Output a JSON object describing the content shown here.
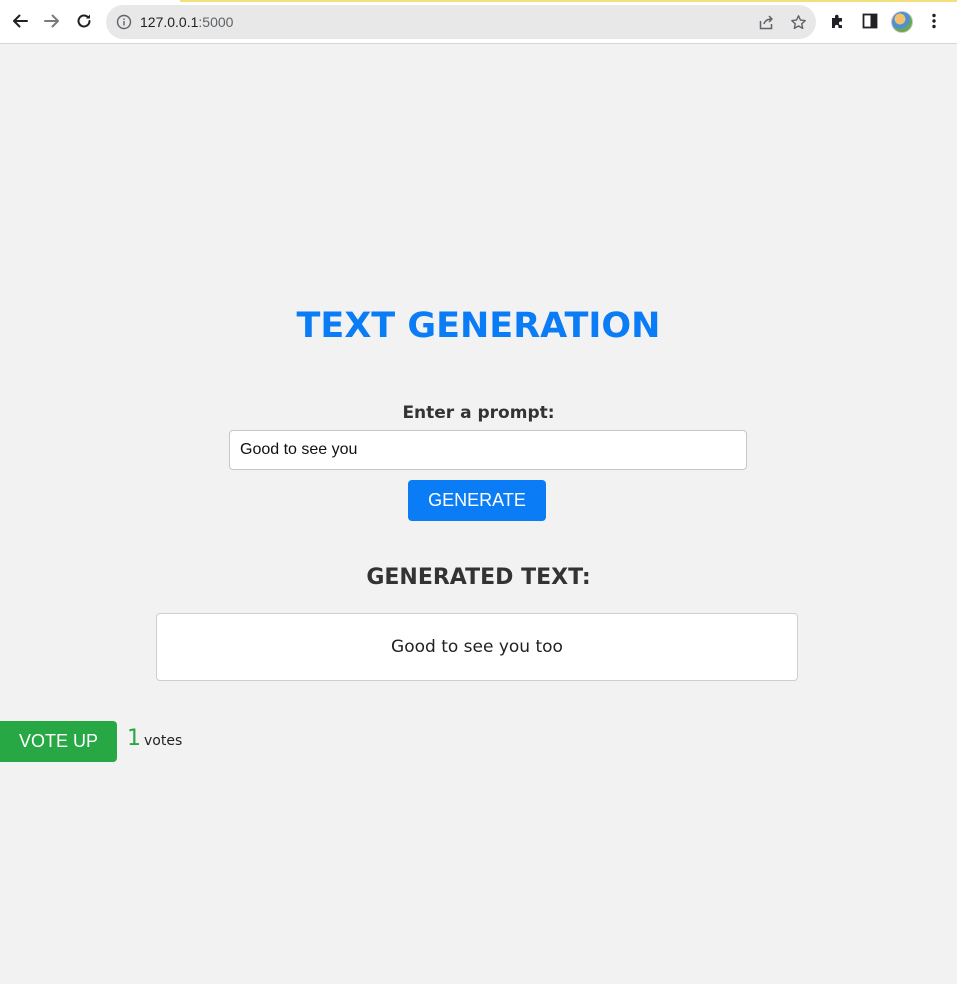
{
  "browser": {
    "url_host": "127.0.0.1",
    "url_port": ":5000"
  },
  "page": {
    "title": "TEXT GENERATION",
    "prompt_label": "Enter a prompt:",
    "prompt_value": "Good to see you",
    "generate_label": "GENERATE",
    "generated_heading": "GENERATED TEXT:",
    "generated_text": "Good to see you too",
    "vote_label": "VOTE UP",
    "vote_count": "1",
    "votes_suffix": "votes"
  },
  "colors": {
    "accent_blue": "#0a7cf5",
    "vote_green": "#28a745",
    "background": "#f2f2f2"
  },
  "icons": {
    "toolbar": [
      "back-icon",
      "forward-icon",
      "reload-icon",
      "info-icon",
      "share-icon",
      "star-icon",
      "extensions-icon",
      "side-panel-icon",
      "avatar",
      "menu-icon"
    ]
  }
}
